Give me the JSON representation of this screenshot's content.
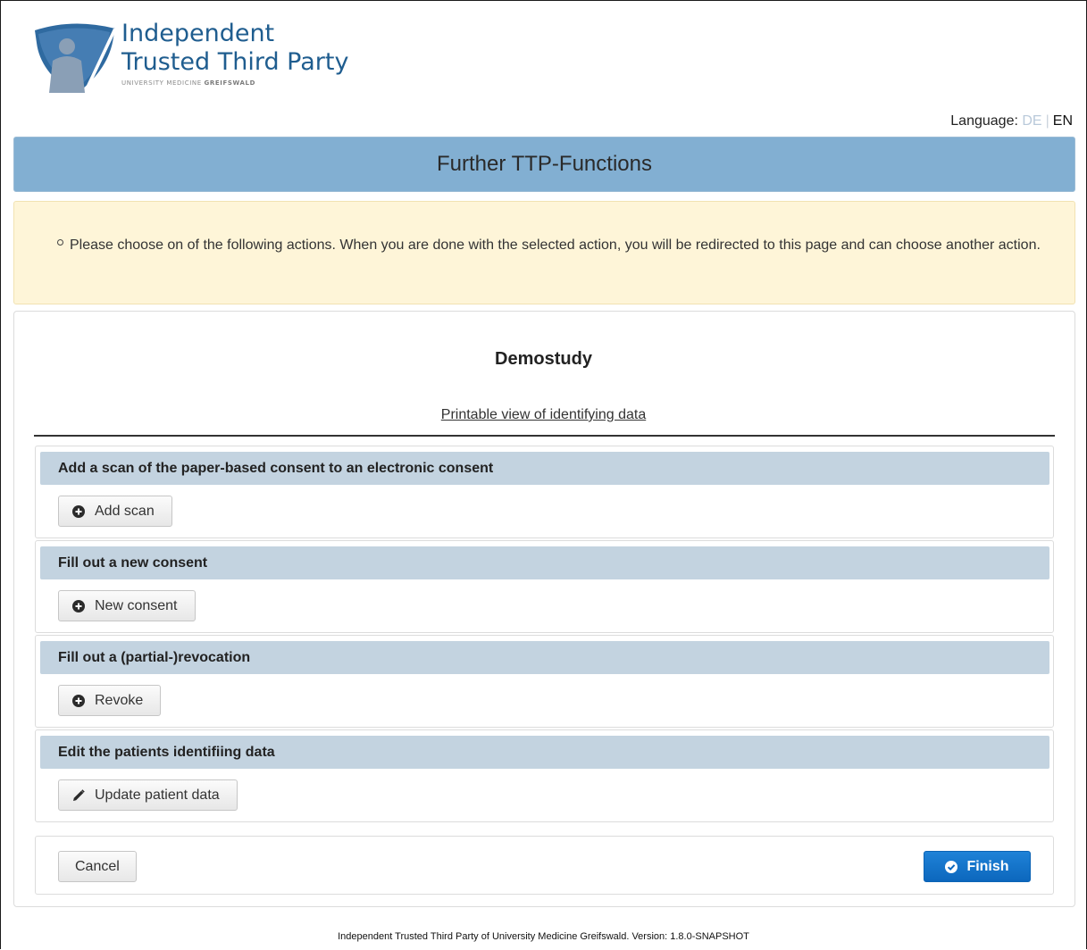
{
  "header": {
    "logo_line1": "Independent",
    "logo_line2": "Trusted Third Party",
    "logo_sub_a": "UNIVERSITY MEDICINE",
    "logo_sub_b": "GREIFSWALD",
    "language_label": "Language:",
    "language_de": "DE",
    "language_sep": "|",
    "language_en": "EN"
  },
  "title_bar": {
    "title": "Further TTP-Functions"
  },
  "info": {
    "message": "Please choose on of the following actions. When you are done with the selected action, you will be redirected to this page and can choose another action."
  },
  "main": {
    "study_name": "Demostudy",
    "printable_link": "Printable view of identifying data",
    "sections": [
      {
        "heading": "Add a scan of the paper-based consent to an electronic consent",
        "button_label": "Add scan",
        "icon": "plus-circle-icon"
      },
      {
        "heading": "Fill out a new consent",
        "button_label": "New consent",
        "icon": "plus-circle-icon"
      },
      {
        "heading": "Fill out a (partial-)revocation",
        "button_label": "Revoke",
        "icon": "plus-circle-icon"
      },
      {
        "heading": "Edit the patients identifiing data",
        "button_label": "Update patient data",
        "icon": "pencil-icon"
      }
    ],
    "cancel_label": "Cancel",
    "finish_label": "Finish"
  },
  "footer": {
    "text": "Independent Trusted Third Party of University Medicine Greifswald. Version: 1.8.0-SNAPSHOT"
  },
  "colors": {
    "title_bar": "#82afd2",
    "info_bg": "#fef5d8",
    "section_head": "#c3d3e0",
    "finish_button": "#0c67bd",
    "logo_text": "#1f5d8f"
  }
}
